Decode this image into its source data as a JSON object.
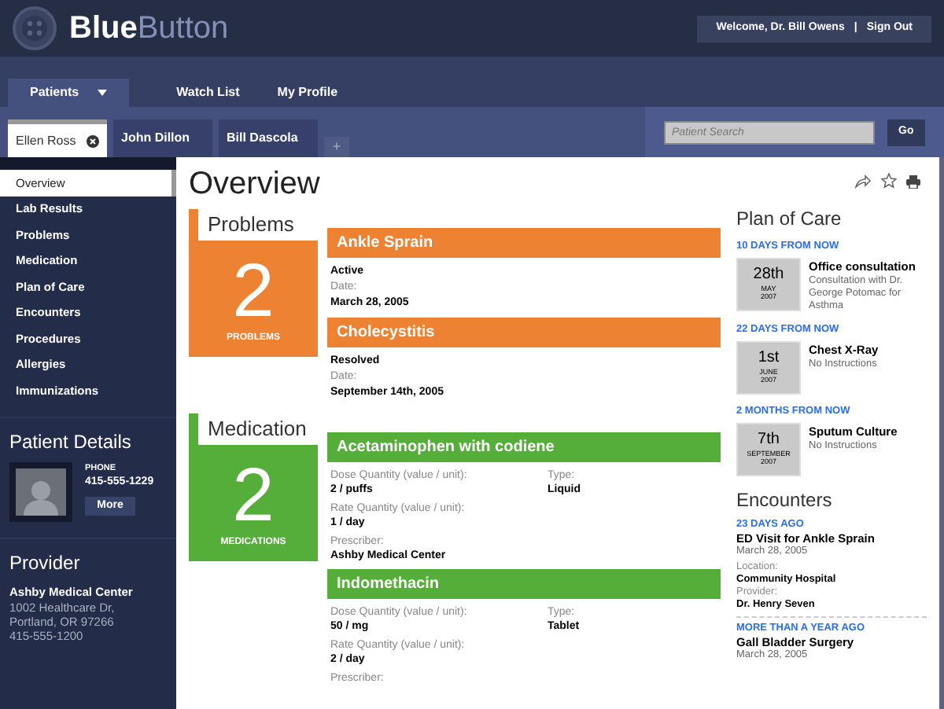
{
  "header": {
    "logo": {
      "bold": "Blue",
      "light": "Button"
    },
    "welcome": "Welcome,  Dr. Bill Owens",
    "separator": "|",
    "sign_out": "Sign Out"
  },
  "nav": [
    {
      "label": "Patients",
      "selected": true,
      "dropdown": true
    },
    {
      "label": "Watch List",
      "selected": false,
      "dropdown": false
    },
    {
      "label": "My Profile",
      "selected": false,
      "dropdown": false
    }
  ],
  "patient_tabs": [
    {
      "label": "Ellen Ross",
      "selected": true
    },
    {
      "label": "John Dillon",
      "selected": false
    },
    {
      "label": "Bill Dascola",
      "selected": false
    }
  ],
  "add_tab": "+",
  "search": {
    "placeholder": "Patient Search",
    "button": "Go"
  },
  "sidebar": {
    "items": [
      {
        "label": "Overview",
        "selected": true
      },
      {
        "label": "Lab Results",
        "selected": false
      },
      {
        "label": "Problems",
        "selected": false
      },
      {
        "label": "Medication",
        "selected": false
      },
      {
        "label": "Plan of Care",
        "selected": false
      },
      {
        "label": "Encounters",
        "selected": false
      },
      {
        "label": "Procedures",
        "selected": false
      },
      {
        "label": "Allergies",
        "selected": false
      },
      {
        "label": "Immunizations",
        "selected": false
      }
    ],
    "patient_details": {
      "title": "Patient Details",
      "phone_label": "PHONE",
      "phone": "415-555-1229",
      "more": "More"
    },
    "provider": {
      "title": "Provider",
      "name": "Ashby Medical Center",
      "address": [
        "1002 Healthcare Dr,",
        "Portland, OR 97266",
        "415-555-1200"
      ]
    }
  },
  "page_title": "Overview",
  "sections": [
    {
      "title": "Problems",
      "color": "#ee8233",
      "count": "2",
      "count_label": "PROBLEMS",
      "kind": "problem",
      "items": [
        {
          "name": "Ankle Sprain",
          "status": "Active",
          "date_label": "Date:",
          "date": "March 28, 2005"
        },
        {
          "name": "Cholecystitis",
          "status": "Resolved",
          "date_label": "Date:",
          "date": "September 14th, 2005"
        }
      ]
    },
    {
      "title": "Medication",
      "color": "#55ad3a",
      "count": "2",
      "count_label": "MEDICATIONS",
      "kind": "medication",
      "items": [
        {
          "name": "Acetaminophen with codiene",
          "fields": [
            {
              "label": "Dose Quantity (value / unit):",
              "value": "2 / puffs"
            },
            {
              "label": "Type:",
              "value": "Liquid"
            },
            {
              "label": "Rate Quantity (value / unit):",
              "value": "1 / day"
            },
            {
              "label": "Prescriber:",
              "value": "Ashby Medical Center"
            }
          ]
        },
        {
          "name": "Indomethacin",
          "fields": [
            {
              "label": "Dose Quantity (value / unit):",
              "value": "50 / mg"
            },
            {
              "label": "Type:",
              "value": "Tablet"
            },
            {
              "label": "Rate Quantity (value / unit):",
              "value": "2 / day"
            },
            {
              "label": "Prescriber:"
            }
          ]
        }
      ]
    }
  ],
  "plan_of_care": {
    "title": "Plan of Care",
    "items": [
      {
        "when": "10 DAYS FROM NOW",
        "day": "28th",
        "month": "MAY",
        "year": "2007",
        "name": "Office consultation",
        "note": "Consultation with Dr. George Potomac for Asthma"
      },
      {
        "when": "22 DAYS FROM NOW",
        "day": "1st",
        "month": "JUNE",
        "year": "2007",
        "name": "Chest X-Ray",
        "note": "No Instructions"
      },
      {
        "when": "2 MONTHS FROM NOW",
        "day": "7th",
        "month": "SEPTEMBER",
        "year": "2007",
        "name": "Sputum Culture",
        "note": "No Instructions"
      }
    ]
  },
  "encounters": {
    "title": "Encounters",
    "items": [
      {
        "when": "23 DAYS AGO",
        "name": "ED Visit for Ankle Sprain",
        "date": "March 28, 2005",
        "fields": [
          {
            "label": "Location:",
            "value": "Community Hospital"
          },
          {
            "label": "Provider:",
            "value": "Dr. Henry Seven"
          }
        ]
      },
      {
        "when": "MORE THAN A YEAR AGO",
        "name": "Gall Bladder Surgery",
        "date": "March 28, 2005"
      }
    ]
  }
}
